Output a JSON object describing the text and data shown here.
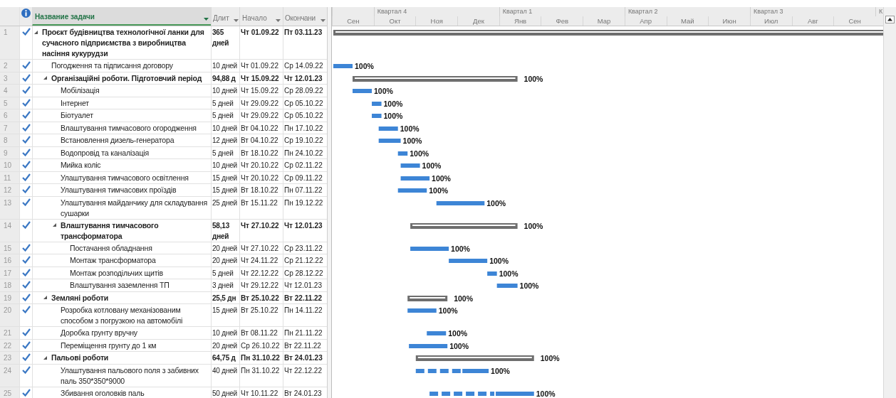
{
  "table": {
    "columns": [
      {
        "label": "Название задачи",
        "selected": true
      },
      {
        "label": "Длит",
        "selected": false
      },
      {
        "label": "Начало",
        "selected": false
      },
      {
        "label": "Окончани",
        "selected": false
      }
    ],
    "tasks": [
      {
        "num": "1",
        "name": "Проєкт будівництва технологічної ланки для сучасного підприємства з виробництва насіння кукурудзи",
        "duration": "365 дней",
        "start": "Чт 01.09.22",
        "finish": "Пт 03.11.23",
        "done": true,
        "kind": "summary",
        "expanded": true,
        "children": [
          {
            "num": "2",
            "name": "Погодження та підписання договору",
            "duration": "10 дней",
            "start": "Чт 01.09.22",
            "finish": "Ср 14.09.22",
            "done": true,
            "kind": "task",
            "percent": "100%"
          },
          {
            "num": "3",
            "name": "Організаційні роботи. Підготовчий період",
            "duration": "94,88 д",
            "start": "Чт 15.09.22",
            "finish": "Чт 12.01.23",
            "done": true,
            "kind": "summary",
            "expanded": true,
            "percent": "100%",
            "children": [
              {
                "num": "4",
                "name": "Мобілізація",
                "duration": "10 дней",
                "start": "Чт 15.09.22",
                "finish": "Ср 28.09.22",
                "done": true,
                "kind": "task",
                "percent": "100%"
              },
              {
                "num": "5",
                "name": "Інтернет",
                "duration": "5 дней",
                "start": "Чт 29.09.22",
                "finish": "Ср 05.10.22",
                "done": true,
                "kind": "task",
                "percent": "100%"
              },
              {
                "num": "6",
                "name": "Біотуалет",
                "duration": "5 дней",
                "start": "Чт 29.09.22",
                "finish": "Ср 05.10.22",
                "done": true,
                "kind": "task",
                "percent": "100%"
              },
              {
                "num": "7",
                "name": "Влаштування тимчасового огородження",
                "duration": "10 дней",
                "start": "Вт 04.10.22",
                "finish": "Пн 17.10.22",
                "done": true,
                "kind": "task",
                "percent": "100%"
              },
              {
                "num": "8",
                "name": "Встановлення дизель-генератора",
                "duration": "12 дней",
                "start": "Вт 04.10.22",
                "finish": "Ср 19.10.22",
                "done": true,
                "kind": "task",
                "percent": "100%"
              },
              {
                "num": "9",
                "name": "Водопровід та каналізація",
                "duration": "5 дней",
                "start": "Вт 18.10.22",
                "finish": "Пн 24.10.22",
                "done": true,
                "kind": "task",
                "percent": "100%"
              },
              {
                "num": "10",
                "name": "Мийка коліс",
                "duration": "10 дней",
                "start": "Чт 20.10.22",
                "finish": "Ср 02.11.22",
                "done": true,
                "kind": "task",
                "percent": "100%"
              },
              {
                "num": "11",
                "name": "Улаштування тимчасового освітлення",
                "duration": "15 дней",
                "start": "Чт 20.10.22",
                "finish": "Ср 09.11.22",
                "done": true,
                "kind": "task",
                "percent": "100%"
              },
              {
                "num": "12",
                "name": "Улаштування тимчасових проїздів",
                "duration": "15 дней",
                "start": "Вт 18.10.22",
                "finish": "Пн 07.11.22",
                "done": true,
                "kind": "task",
                "percent": "100%"
              },
              {
                "num": "13",
                "name": "Улаштування майданчику для складування сушарки",
                "duration": "25 дней",
                "start": "Вт 15.11.22",
                "finish": "Пн 19.12.22",
                "done": true,
                "kind": "task",
                "percent": "100%"
              },
              {
                "num": "14",
                "name": "Влаштування тимчасового трансформатора",
                "duration": "58,13 дней",
                "start": "Чт 27.10.22",
                "finish": "Чт 12.01.23",
                "done": true,
                "kind": "summary",
                "expanded": true,
                "percent": "100%",
                "children": [
                  {
                    "num": "15",
                    "name": "Постачання обладнання",
                    "duration": "20 дней",
                    "start": "Чт 27.10.22",
                    "finish": "Ср 23.11.22",
                    "done": true,
                    "kind": "task",
                    "percent": "100%"
                  },
                  {
                    "num": "16",
                    "name": "Монтаж трансформатора",
                    "duration": "20 дней",
                    "start": "Чт 24.11.22",
                    "finish": "Ср 21.12.22",
                    "done": true,
                    "kind": "task",
                    "percent": "100%"
                  },
                  {
                    "num": "17",
                    "name": "Монтаж розподільчих щитів",
                    "duration": "5 дней",
                    "start": "Чт 22.12.22",
                    "finish": "Ср 28.12.22",
                    "done": true,
                    "kind": "task",
                    "percent": "100%"
                  },
                  {
                    "num": "18",
                    "name": "Влаштування заземлення ТП",
                    "duration": "3 дней",
                    "start": "Чт 29.12.22",
                    "finish": "Чт 12.01.23",
                    "done": true,
                    "kind": "task",
                    "percent": "100%"
                  }
                ]
              }
            ]
          },
          {
            "num": "19",
            "name": "Земляні роботи",
            "duration": "25,5 дн",
            "start": "Вт 25.10.22",
            "finish": "Вт 22.11.22",
            "done": true,
            "kind": "summary",
            "expanded": true,
            "percent": "100%",
            "children": [
              {
                "num": "20",
                "name": "Розробка котловану механізованим способом з погрузкою на автомобілі",
                "duration": "15 дней",
                "start": "Вт 25.10.22",
                "finish": "Пн 14.11.22",
                "done": true,
                "kind": "task",
                "percent": "100%"
              },
              {
                "num": "21",
                "name": "Доробка грунту вручну",
                "duration": "10 дней",
                "start": "Вт 08.11.22",
                "finish": "Пн 21.11.22",
                "done": true,
                "kind": "task",
                "percent": "100%"
              },
              {
                "num": "22",
                "name": "Переміщення грунту до 1 км",
                "duration": "20 дней",
                "start": "Ср 26.10.22",
                "finish": "Вт 22.11.22",
                "done": true,
                "kind": "task",
                "percent": "100%"
              }
            ]
          },
          {
            "num": "23",
            "name": "Пальові роботи",
            "duration": "64,75 д",
            "start": "Пн 31.10.22",
            "finish": "Вт 24.01.23",
            "done": true,
            "kind": "summary",
            "expanded": true,
            "percent": "100%",
            "children": [
              {
                "num": "24",
                "name": "Улаштування пальового поля з забивних паль 350*350*9000",
                "duration": "40 дней",
                "start": "Пн 31.10.22",
                "finish": "Чт 22.12.22",
                "done": true,
                "kind": "split",
                "percent": "100%"
              },
              {
                "num": "25",
                "name": "Збивання оголовків паль",
                "duration": "50 дней",
                "start": "Чт 10.11.22",
                "finish": "Вт 24.01.23",
                "done": true,
                "kind": "split",
                "percent": "100%"
              }
            ]
          }
        ]
      }
    ]
  },
  "timescale": {
    "quarters": [
      {
        "label": "Квартал 4"
      },
      {
        "label": "Квартал 1"
      },
      {
        "label": "Квартал 2"
      },
      {
        "label": "Квартал 3"
      },
      {
        "label": "К"
      }
    ],
    "months": [
      {
        "label": "Сен"
      },
      {
        "label": "Окт"
      },
      {
        "label": "Ноя"
      },
      {
        "label": "Дек"
      },
      {
        "label": "Янв"
      },
      {
        "label": "Фев"
      },
      {
        "label": "Мар"
      },
      {
        "label": "Апр"
      },
      {
        "label": "Май"
      },
      {
        "label": "Июн"
      },
      {
        "label": "Июл"
      },
      {
        "label": "Авг"
      },
      {
        "label": "Сен"
      }
    ]
  }
}
